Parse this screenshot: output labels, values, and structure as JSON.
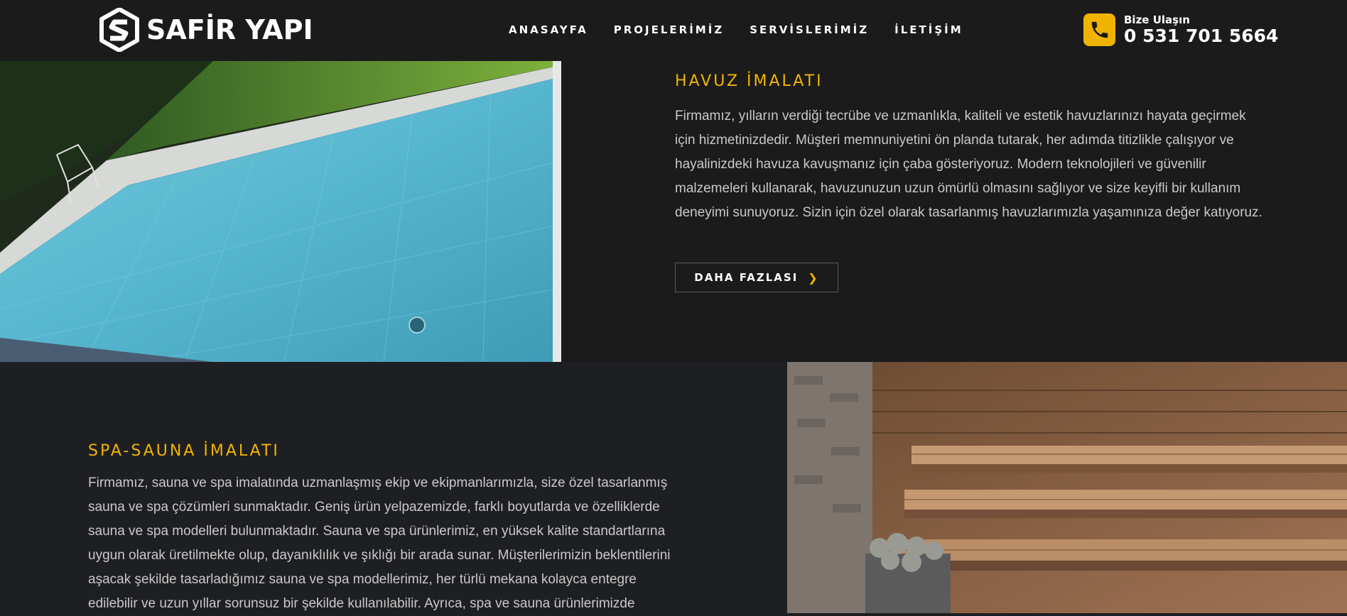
{
  "brand": {
    "name": "SAFİR YAPI",
    "logo_icon": "s-cube-logo"
  },
  "nav": {
    "items": [
      {
        "label": "ANASAYFA"
      },
      {
        "label": "PROJELERİMİZ"
      },
      {
        "label": "SERVİSLERİMİZ"
      },
      {
        "label": "İLETİŞİM"
      }
    ]
  },
  "contact": {
    "icon": "phone-icon",
    "label": "Bize Ulaşın",
    "number": "0 531 701 5664"
  },
  "colors": {
    "accent": "#f0b400",
    "background": "#1b1b1c",
    "text": "#c9c9c9"
  },
  "section_pool": {
    "title": "HAVUZ İMALATI",
    "text": "Firmamız, yılların verdiği tecrübe ve uzmanlıkla, kaliteli ve estetik havuzlarınızı hayata geçirmek için hizmetinizdedir. Müşteri memnuniyetini ön planda tutarak, her adımda titizlikle çalışıyor ve hayalinizdeki havuza kavuşmanız için çaba gösteriyoruz. Modern teknolojileri ve güvenilir malzemeleri kullanarak, havuzunuzun uzun ömürlü olmasını sağlıyor ve size keyifli bir kullanım deneyimi sunuyoruz. Sizin için özel olarak tasarlanmış havuzlarımızla yaşamınıza değer katıyoruz.",
    "button_label": "DAHA FAZLASI",
    "button_icon": "chevron-right-icon"
  },
  "section_sauna": {
    "title": "SPA-SAUNA İMALATI",
    "text": "Firmamız, sauna ve spa imalatında uzmanlaşmış ekip ve ekipmanlarımızla, size özel tasarlanmış sauna ve spa çözümleri sunmaktadır. Geniş ürün yelpazemizde, farklı boyutlarda ve özelliklerde sauna ve spa modelleri bulunmaktadır. Sauna ve spa ürünlerimiz, en yüksek kalite standartlarına uygun olarak üretilmekte olup, dayanıklılık ve şıklığı bir arada sunar. Müşterilerimizin beklentilerini aşacak şekilde tasarladığımız sauna ve spa modellerimiz, her türlü mekana kolayca entegre edilebilir ve uzun yıllar sorunsuz bir şekilde kullanılabilir. Ayrıca, spa ve sauna ürünlerimizde"
  }
}
